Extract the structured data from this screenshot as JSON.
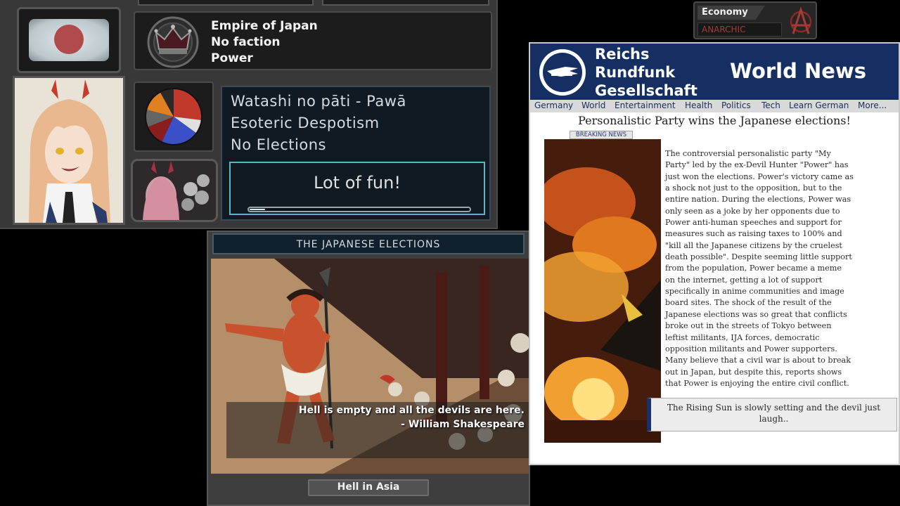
{
  "country": {
    "name": "Empire of Japan",
    "faction": "No faction",
    "leader_name": "Power",
    "party": "Watashi no pāti - Pawā",
    "ideology": "Esoteric Despotism",
    "elections": "No Elections",
    "status_button": "Lot of fun!",
    "progress_fraction": 0.07,
    "party_popularity": [
      {
        "color": "#c0392b",
        "value": 0.27
      },
      {
        "color": "#e0e0e0",
        "value": 0.08
      },
      {
        "color": "#3a4fc8",
        "value": 0.22
      },
      {
        "color": "#8a1e1e",
        "value": 0.12
      },
      {
        "color": "#666666",
        "value": 0.1
      },
      {
        "color": "#e08020",
        "value": 0.13
      },
      {
        "color": "#2a2a2a",
        "value": 0.08
      }
    ]
  },
  "economy": {
    "label": "Economy",
    "value": "ANARCHIC",
    "icon": "anarchy-icon",
    "value_color": "#a73a36"
  },
  "event": {
    "title": "THE JAPANESE ELECTIONS",
    "quote_line1": "Hell is empty and all the devils are here.",
    "quote_line2": "- William Shakespeare",
    "option": "Hell in Asia"
  },
  "news": {
    "outlet_line1": "Reichs",
    "outlet_line2": "Rundfunk",
    "outlet_line3": "Gesellschaft",
    "section": "World News",
    "nav": [
      "Germany",
      "World",
      "Entertainment",
      "Health",
      "Politics",
      "Tech",
      "Learn German",
      "More..."
    ],
    "headline": "Personalistic Party wins the Japanese elections!",
    "tag": "BREAKING NEWS",
    "body": [
      "The controversial personalistic party \"My",
      "Party\" led by the ex-Devil Hunter \"Power\" has",
      "just won the elections. Power's victory came as",
      "a shock not just to the opposition, but to the",
      "entire nation. During the elections, Power was",
      "only seen as a joke by her opponents due to",
      "Power anti-human speeches and support for",
      "measures such as raising taxes to 100% and",
      "\"kill all the Japanese citizens by the cruelest",
      "death possible\". Despite seeming little support",
      "from the population, Power became a meme",
      "on the internet, getting a lot of support",
      "specifically in anime communities and image",
      "board sites. The shock of the result of the",
      "Japanese elections was so great that conflicts",
      "broke out in the streets of Tokyo between",
      "leftist militants, IJA forces, democratic",
      "opposition militants and Power supporters.",
      "Many believe that a civil war is about to break",
      "out in Japan, but despite this, reports shows",
      "that Power is enjoying the entire civil conflict."
    ],
    "caption_line1": "The Rising Sun is slowly setting and the devil just",
    "caption_line2": "laugh.."
  }
}
